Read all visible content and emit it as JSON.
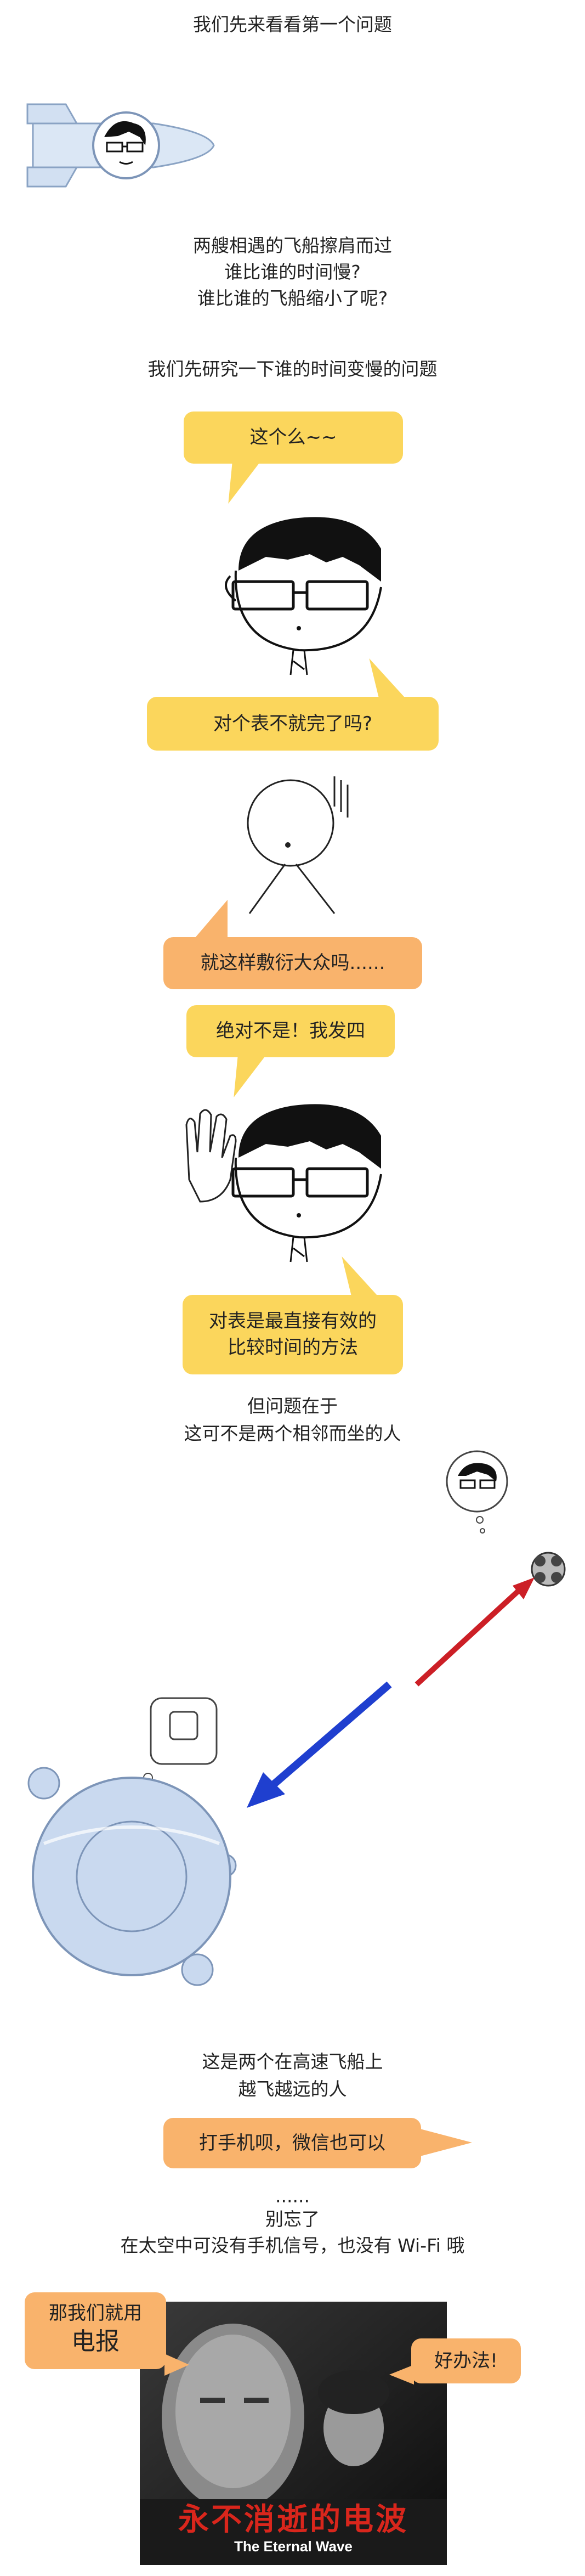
{
  "intro": "我们先来看看第一个问题",
  "question": {
    "line1": "两艘相遇的飞船擦肩而过",
    "line2": "谁比谁的时间慢?",
    "line3": "谁比谁的飞船缩小了呢?"
  },
  "research": "我们先研究一下谁的时间变慢的问题",
  "bubble_this": "这个么~~",
  "bubble_watch": "对个表不就完了吗?",
  "bubble_perfunctory": "就这样敷衍大众吗......",
  "bubble_no": "绝对不是！我发四",
  "bubble_method": {
    "line1": "对表是最直接有效的",
    "line2": "比较时间的方法"
  },
  "problem": {
    "line1": "但问题在于",
    "line2": "这可不是两个相邻而坐的人"
  },
  "ships": {
    "line1": "这是两个在高速飞船上",
    "line2": "越飞越远的人"
  },
  "bubble_phone": "打手机呗，微信也可以",
  "forgot": {
    "dots": "......",
    "line1": "别忘了",
    "line2": "在太空中可没有手机信号，也没有 Wi-Fi 哦"
  },
  "bubble_telegraph": {
    "line1": "那我们就用",
    "line2": "电报"
  },
  "bubble_good": "好办法!",
  "poster": {
    "title_cn": "永不消逝的电波",
    "title_en": "The Eternal Wave"
  },
  "colors": {
    "yellow": "#fbd65c",
    "orange": "#f9b36c",
    "red_arrow": "#cc1f26",
    "blue_arrow": "#1f3fcf",
    "ship": "#c9d9ef"
  }
}
